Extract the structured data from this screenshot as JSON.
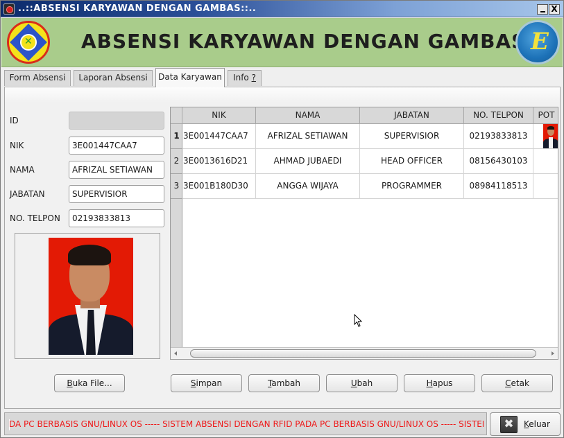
{
  "window": {
    "title": "..::ABSENSI KARYAWAN DENGAN GAMBAS::..",
    "minimize_label": "_",
    "close_label": "X"
  },
  "banner": {
    "title": "ABSENSI KARYAWAN DENGAN GAMBAS",
    "left_logo": "campus-emblem-logo",
    "right_logo": "hima-elektro-logo"
  },
  "tabs": [
    {
      "label": "Form Absensi",
      "active": false
    },
    {
      "label": "Laporan Absensi",
      "active": false
    },
    {
      "label": "Data Karyawan",
      "active": true
    },
    {
      "label_main": "Info ",
      "label_hotkey": "?",
      "active": false
    }
  ],
  "form": {
    "id": {
      "label": "ID",
      "value": "",
      "enabled": false
    },
    "nik": {
      "label": "NIK",
      "value": "3E001447CAA7"
    },
    "nama": {
      "label": "NAMA",
      "value": "AFRIZAL SETIAWAN"
    },
    "jabatan": {
      "label": "JABATAN",
      "value": "SUPERVISIOR"
    },
    "telpon": {
      "label": "NO. TELPON",
      "value": "02193833813"
    },
    "photo": "employee-photo",
    "open_file_button": {
      "hotkey": "B",
      "rest": "uka File..."
    }
  },
  "table": {
    "columns": [
      "NIK",
      "NAMA",
      "JABATAN",
      "NO. TELPON",
      "POTO"
    ],
    "column_header_visible": [
      "NIK",
      "NAMA",
      "JABATAN",
      "NO. TELPON",
      "POT"
    ],
    "rows": [
      {
        "num": "1",
        "nik": "3E001447CAA7",
        "nama": "AFRIZAL SETIAWAN",
        "jabatan": "SUPERVISIOR",
        "telpon": "02193833813",
        "has_photo": true,
        "selected": true
      },
      {
        "num": "2",
        "nik": "3E0013616D21",
        "nama": "AHMAD JUBAEDI",
        "jabatan": "HEAD OFFICER",
        "telpon": "08156430103",
        "has_photo": false
      },
      {
        "num": "3",
        "nik": "3E001B180D30",
        "nama": "ANGGA WIJAYA",
        "jabatan": "PROGRAMMER",
        "telpon": "08984118513",
        "has_photo": false
      }
    ]
  },
  "actions": [
    {
      "hotkey": "S",
      "rest": "impan"
    },
    {
      "hotkey": "T",
      "rest": "ambah"
    },
    {
      "hotkey": "U",
      "rest": "bah"
    },
    {
      "hotkey": "H",
      "rest": "apus"
    },
    {
      "hotkey": "C",
      "rest": "etak"
    }
  ],
  "footer": {
    "marquee_text": "DA PC BERBASIS GNU/LINUX OS ----- SISTEM ABSENSI DENGAN RFID PADA PC BERBASIS GNU/LINUX OS ----- SISTEM",
    "marquee_color": "#ee1a1a",
    "exit_button": {
      "hotkey": "K",
      "rest": "eluar"
    }
  },
  "colors": {
    "banner_bg": "#a9cc8b",
    "titlebar_start": "#0c2b6c",
    "titlebar_end": "#a7c6ea"
  }
}
